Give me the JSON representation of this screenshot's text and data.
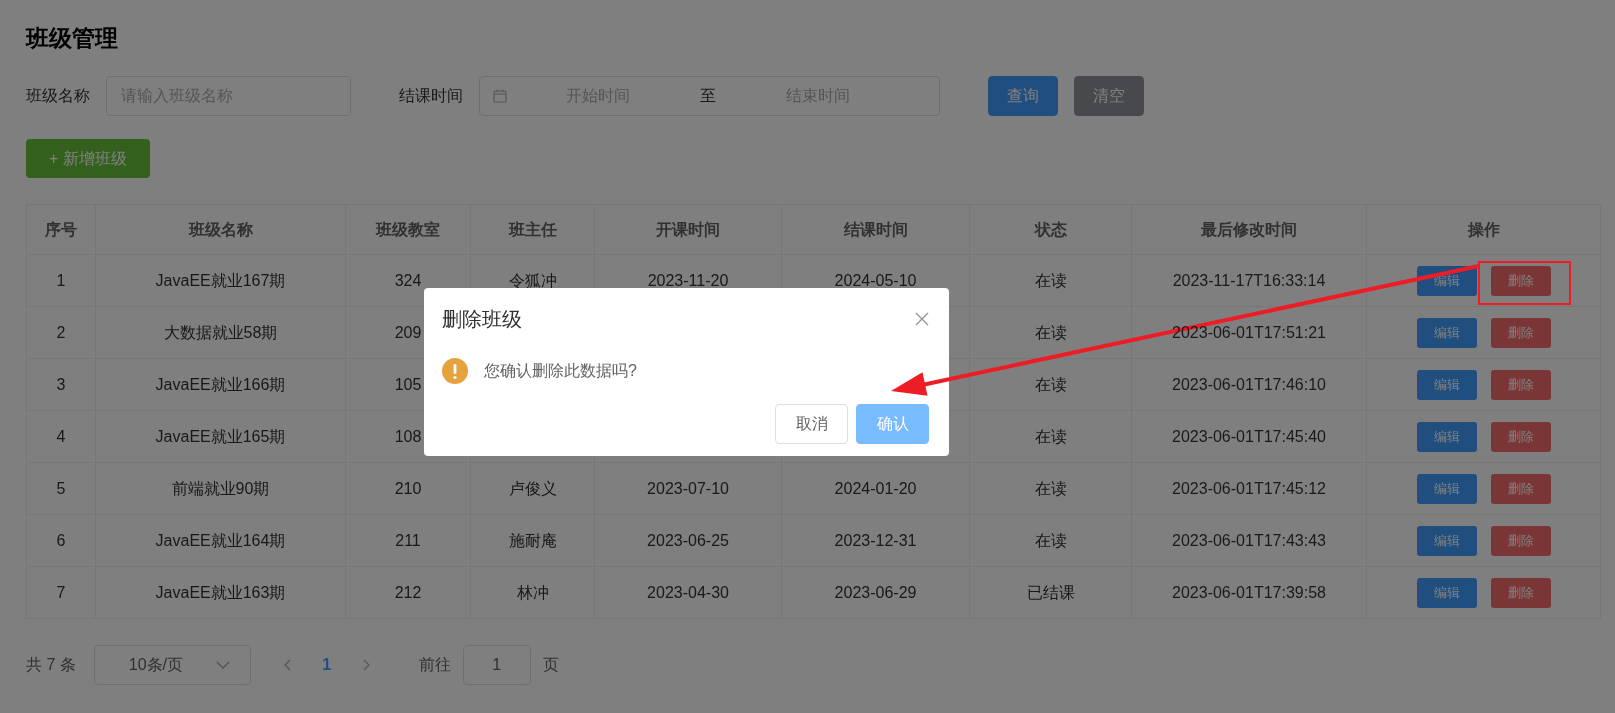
{
  "page": {
    "title": "班级管理"
  },
  "filters": {
    "name": {
      "label": "班级名称",
      "placeholder": "请输入班级名称"
    },
    "date": {
      "label": "结课时间",
      "start_placeholder": "开始时间",
      "separator": "至",
      "end_placeholder": "结束时间"
    },
    "buttons": [
      {
        "label": "查询",
        "kind": "primary"
      },
      {
        "label": "清空",
        "kind": "info"
      }
    ]
  },
  "add_button": "+ 新增班级",
  "table": {
    "columns": [
      "序号",
      "班级名称",
      "班级教室",
      "班主任",
      "开课时间",
      "结课时间",
      "状态",
      "最后修改时间",
      "操作"
    ],
    "rows": [
      {
        "cells": [
          "1",
          "JavaEE就业167期",
          "324",
          "令狐冲",
          "2023-11-20",
          "2024-05-10",
          "在读",
          "2023-11-17T16:33:14"
        ],
        "actions": [
          "编辑",
          "删除"
        ]
      },
      {
        "cells": [
          "2",
          "大数据就业58期",
          "209",
          null,
          null,
          null,
          "在读",
          "2023-06-01T17:51:21"
        ],
        "actions": [
          "编辑",
          "删除"
        ]
      },
      {
        "cells": [
          "3",
          "JavaEE就业166期",
          "105",
          null,
          null,
          null,
          "在读",
          "2023-06-01T17:46:10"
        ],
        "actions": [
          "编辑",
          "删除"
        ]
      },
      {
        "cells": [
          "4",
          "JavaEE就业165期",
          "108",
          null,
          null,
          null,
          "在读",
          "2023-06-01T17:45:40"
        ],
        "actions": [
          "编辑",
          "删除"
        ]
      },
      {
        "cells": [
          "5",
          "前端就业90期",
          "210",
          "卢俊义",
          "2023-07-10",
          "2024-01-20",
          "在读",
          "2023-06-01T17:45:12"
        ],
        "actions": [
          "编辑",
          "删除"
        ]
      },
      {
        "cells": [
          "6",
          "JavaEE就业164期",
          "211",
          "施耐庵",
          "2023-06-25",
          "2023-12-31",
          "在读",
          "2023-06-01T17:43:43"
        ],
        "actions": [
          "编辑",
          "删除"
        ]
      },
      {
        "cells": [
          "7",
          "JavaEE就业163期",
          "212",
          "林冲",
          "2023-04-30",
          "2023-06-29",
          "已结课",
          "2023-06-01T17:39:58"
        ],
        "actions": [
          "编辑",
          "删除"
        ]
      }
    ]
  },
  "pagination": {
    "total": "共 7 条",
    "page_size": "10条/页",
    "pages": [
      {
        "label": "1",
        "selected": true
      }
    ],
    "goto_label": "前往",
    "goto_value": "1",
    "goto_suffix": "页"
  },
  "dialog": {
    "title": "删除班级",
    "message": "您确认删除此数据吗?",
    "buttons": [
      {
        "label": "取消",
        "kind": "default"
      },
      {
        "label": "确认",
        "kind": "primary"
      }
    ]
  }
}
